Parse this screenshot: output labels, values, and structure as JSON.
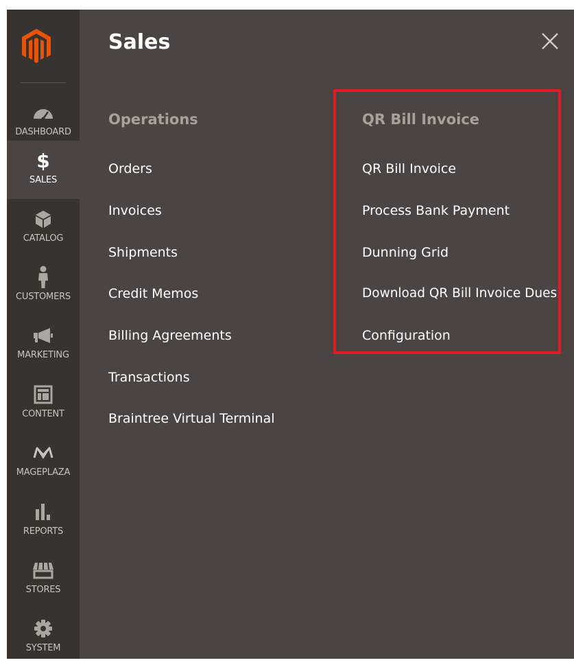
{
  "sidebar": {
    "logo": "magento-logo",
    "items": [
      {
        "label": "DASHBOARD",
        "icon": "speedometer-icon"
      },
      {
        "label": "SALES",
        "icon": "dollar-icon",
        "active": true
      },
      {
        "label": "CATALOG",
        "icon": "box-icon"
      },
      {
        "label": "CUSTOMERS",
        "icon": "person-icon"
      },
      {
        "label": "MARKETING",
        "icon": "megaphone-icon"
      },
      {
        "label": "CONTENT",
        "icon": "layout-icon"
      },
      {
        "label": "MAGEPLAZA",
        "icon": "mageplaza-icon"
      },
      {
        "label": "REPORTS",
        "icon": "bar-chart-icon"
      },
      {
        "label": "STORES",
        "icon": "storefront-icon"
      },
      {
        "label": "SYSTEM",
        "icon": "gear-icon"
      }
    ]
  },
  "panel": {
    "title": "Sales",
    "close_icon": "close-icon",
    "groups": [
      {
        "title": "Operations",
        "links": [
          "Orders",
          "Invoices",
          "Shipments",
          "Credit Memos",
          "Billing Agreements",
          "Transactions",
          "Braintree Virtual Terminal"
        ]
      },
      {
        "title": "QR Bill Invoice",
        "links": [
          "QR Bill Invoice",
          "Process Bank Payment",
          "Dunning Grid",
          "Download QR Bill Invoice Dues",
          "Configuration"
        ],
        "highlighted": true
      }
    ]
  },
  "colors": {
    "sidebar_bg": "#373330",
    "panel_bg": "#4a4542",
    "brand_orange": "#eb5202",
    "highlight_red": "#e11b24"
  }
}
